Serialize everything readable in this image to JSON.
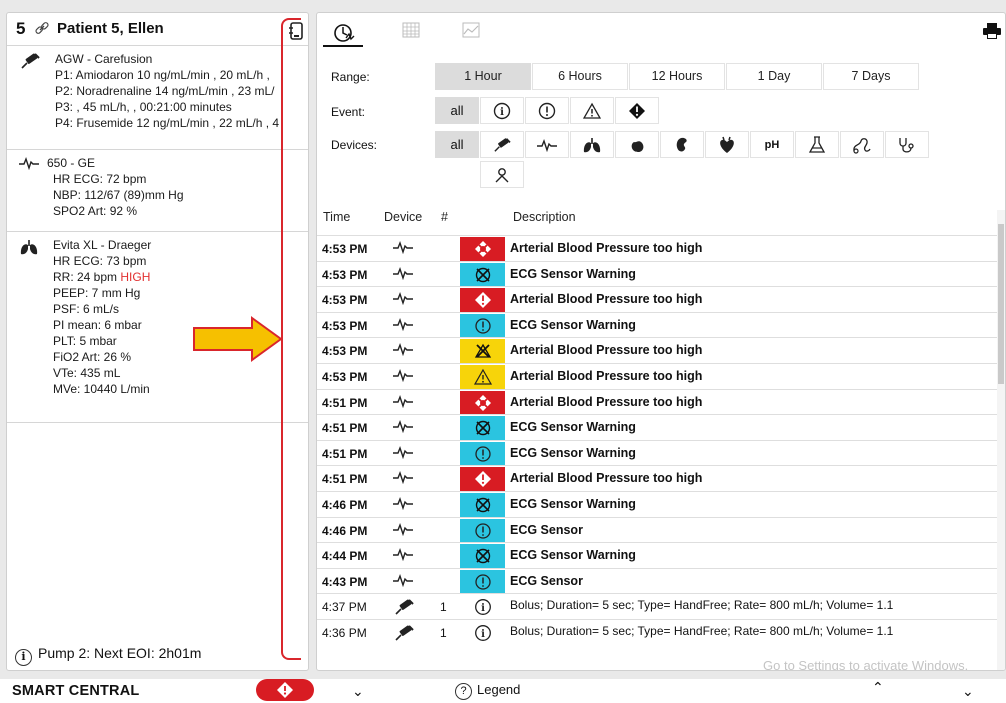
{
  "patient": {
    "number": "5",
    "name": "Patient 5, Ellen",
    "sections": [
      {
        "device": "AGW - Carefusion",
        "lines": [
          "P1: Amiodaron 10 ng/mL/min , 20 mL/h ,",
          "P2: Noradrenaline 14 ng/mL/min , 23 mL/",
          "P3: , 45 mL/h, , 00:21:00 minutes",
          "P4: Frusemide 12 ng/mL/min , 22 mL/h , 4"
        ]
      },
      {
        "device": "650 - GE",
        "lines": [
          "HR ECG: 72 bpm",
          "NBP: 112/67 (89)mm Hg",
          "SPO2 Art: 92 %"
        ]
      },
      {
        "device": "Evita XL - Draeger",
        "lines": [
          "HR ECG: 73 bpm",
          "RR: 24 bpm",
          "PEEP: 7 mm Hg",
          "PSF: 6 mL/s",
          "PI mean: 6 mbar",
          "PLT: 5 mbar",
          "FiO2 Art: 26 %",
          "VTe: 435 mL",
          "MVe: 10440 L/min"
        ],
        "rr_flag": "HIGH"
      }
    ],
    "footer_info": "Pump 2: Next EOI: 2h01m"
  },
  "filters": {
    "range_label": "Range:",
    "ranges": [
      "1 Hour",
      "6 Hours",
      "12 Hours",
      "1 Day",
      "7 Days"
    ],
    "selected_range": "1 Hour",
    "event_label": "Event:",
    "event_all": "all",
    "devices_label": "Devices:",
    "devices_all": "all",
    "ph_label": "pH"
  },
  "table": {
    "headers": {
      "time": "Time",
      "device": "Device",
      "num": "#",
      "description": "Description"
    },
    "rows": [
      {
        "time": "4:53 PM",
        "device": "ecg",
        "num": "",
        "sev": "red-x",
        "desc": "Arterial Blood Pressure too high",
        "bold": true
      },
      {
        "time": "4:53 PM",
        "device": "ecg",
        "num": "",
        "sev": "cyan-x",
        "desc": "ECG Sensor Warning",
        "bold": true
      },
      {
        "time": "4:53 PM",
        "device": "ecg",
        "num": "",
        "sev": "red-diamond",
        "desc": "Arterial Blood Pressure too high",
        "bold": true
      },
      {
        "time": "4:53 PM",
        "device": "ecg",
        "num": "",
        "sev": "cyan-circle",
        "desc": "ECG Sensor Warning",
        "bold": true
      },
      {
        "time": "4:53 PM",
        "device": "ecg",
        "num": "",
        "sev": "yellow-x",
        "desc": "Arterial Blood Pressure too high",
        "bold": true
      },
      {
        "time": "4:53 PM",
        "device": "ecg",
        "num": "",
        "sev": "yellow-triangle",
        "desc": "Arterial Blood Pressure too high",
        "bold": true
      },
      {
        "time": "4:51 PM",
        "device": "ecg",
        "num": "",
        "sev": "red-x",
        "desc": "Arterial Blood Pressure too high",
        "bold": true
      },
      {
        "time": "4:51 PM",
        "device": "ecg",
        "num": "",
        "sev": "cyan-x",
        "desc": "ECG Sensor Warning",
        "bold": true
      },
      {
        "time": "4:51 PM",
        "device": "ecg",
        "num": "",
        "sev": "cyan-circle",
        "desc": "ECG Sensor Warning",
        "bold": true
      },
      {
        "time": "4:51 PM",
        "device": "ecg",
        "num": "",
        "sev": "red-diamond",
        "desc": "Arterial Blood Pressure too high",
        "bold": true
      },
      {
        "time": "4:46 PM",
        "device": "ecg",
        "num": "",
        "sev": "cyan-x",
        "desc": "ECG Sensor Warning",
        "bold": true
      },
      {
        "time": "4:46 PM",
        "device": "ecg",
        "num": "",
        "sev": "cyan-circle",
        "desc": "ECG Sensor",
        "bold": true
      },
      {
        "time": "4:44 PM",
        "device": "ecg",
        "num": "",
        "sev": "cyan-x",
        "desc": "ECG Sensor Warning",
        "bold": true
      },
      {
        "time": "4:43 PM",
        "device": "ecg",
        "num": "",
        "sev": "cyan-circle",
        "desc": "ECG Sensor",
        "bold": true
      },
      {
        "time": "4:37 PM",
        "device": "syringe",
        "num": "1",
        "sev": "info",
        "desc": "Bolus; Duration= 5 sec; Type= HandFree; Rate= 800 mL/h; Volume= 1.1",
        "bold": false
      },
      {
        "time": "4:36 PM",
        "device": "syringe",
        "num": "1",
        "sev": "info",
        "desc": "Bolus; Duration= 5 sec; Type= HandFree; Rate= 800 mL/h; Volume= 1.1",
        "bold": false
      }
    ]
  },
  "watermark": "Go to Settings to activate Windows.",
  "footer": {
    "brand": "SMART CENTRAL",
    "legend": "Legend"
  },
  "colors": {
    "red": "#d81c23",
    "cyan": "#2bc4e0",
    "yellow": "#f7d40a",
    "arrow": "#f6c000",
    "arrow_border": "#d9262c"
  }
}
